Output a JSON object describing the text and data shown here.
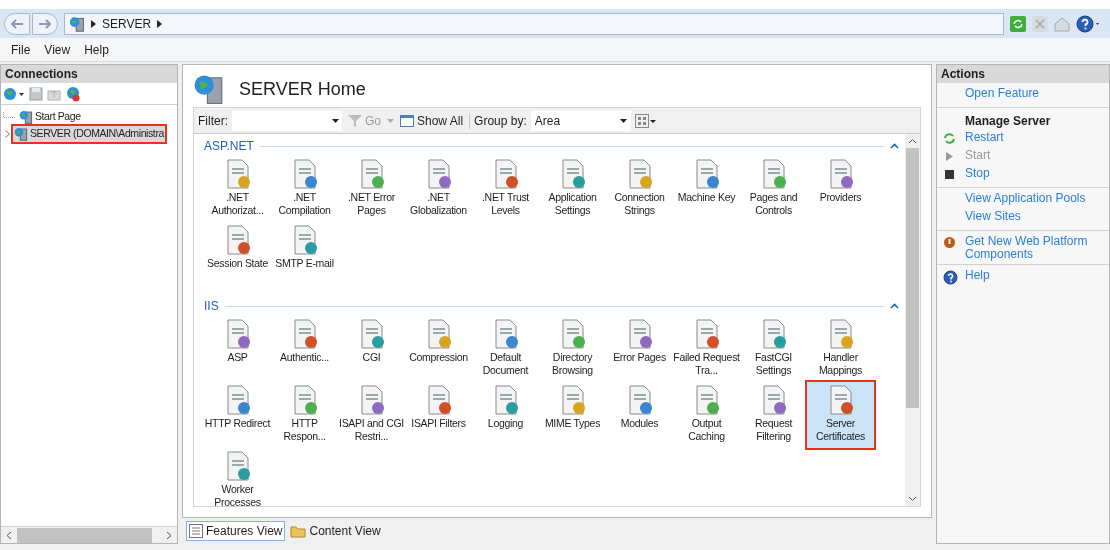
{
  "address_bar": {
    "crumbs": [
      "SERVER"
    ]
  },
  "menu": [
    "File",
    "View",
    "Help"
  ],
  "connections": {
    "title": "Connections",
    "tree": [
      {
        "label": "Start Page",
        "selected": false,
        "expandable": false
      },
      {
        "label": "SERVER (DOMAIN\\Administra",
        "selected": true,
        "expandable": true
      }
    ]
  },
  "center": {
    "title": "SERVER Home",
    "toolbar": {
      "filter_label": "Filter:",
      "go": "Go",
      "show_all": "Show All",
      "group_by_label": "Group by:",
      "group_by_value": "Area"
    },
    "groups": [
      {
        "name": "ASP.NET",
        "items": [
          {
            "label": ".NET Authorizat...",
            "selected": false
          },
          {
            "label": ".NET Compilation",
            "selected": false
          },
          {
            "label": ".NET Error Pages",
            "selected": false
          },
          {
            "label": ".NET Globalization",
            "selected": false
          },
          {
            "label": ".NET Trust Levels",
            "selected": false
          },
          {
            "label": "Application Settings",
            "selected": false
          },
          {
            "label": "Connection Strings",
            "selected": false
          },
          {
            "label": "Machine Key",
            "selected": false
          },
          {
            "label": "Pages and Controls",
            "selected": false
          },
          {
            "label": "Providers",
            "selected": false
          },
          {
            "label": "Session State",
            "selected": false
          },
          {
            "label": "SMTP E-mail",
            "selected": false
          }
        ]
      },
      {
        "name": "IIS",
        "items": [
          {
            "label": "ASP",
            "selected": false
          },
          {
            "label": "Authentic...",
            "selected": false
          },
          {
            "label": "CGI",
            "selected": false
          },
          {
            "label": "Compression",
            "selected": false
          },
          {
            "label": "Default Document",
            "selected": false
          },
          {
            "label": "Directory Browsing",
            "selected": false
          },
          {
            "label": "Error Pages",
            "selected": false
          },
          {
            "label": "Failed Request Tra...",
            "selected": false
          },
          {
            "label": "FastCGI Settings",
            "selected": false
          },
          {
            "label": "Handler Mappings",
            "selected": false
          },
          {
            "label": "HTTP Redirect",
            "selected": false
          },
          {
            "label": "HTTP Respon...",
            "selected": false
          },
          {
            "label": "ISAPI and CGI Restri...",
            "selected": false
          },
          {
            "label": "ISAPI Filters",
            "selected": false
          },
          {
            "label": "Logging",
            "selected": false
          },
          {
            "label": "MIME Types",
            "selected": false
          },
          {
            "label": "Modules",
            "selected": false
          },
          {
            "label": "Output Caching",
            "selected": false
          },
          {
            "label": "Request Filtering",
            "selected": false
          },
          {
            "label": "Server Certificates",
            "selected": true
          },
          {
            "label": "Worker Processes",
            "selected": false
          }
        ]
      }
    ],
    "view_tabs": [
      {
        "label": "Features View",
        "selected": true
      },
      {
        "label": "Content View",
        "selected": false
      }
    ]
  },
  "actions": {
    "title": "Actions",
    "groups": [
      [
        {
          "kind": "link",
          "label": "Open Feature",
          "disabled": false
        }
      ],
      [
        {
          "kind": "heading",
          "label": "Manage Server"
        },
        {
          "kind": "restart",
          "label": "Restart",
          "disabled": false
        },
        {
          "kind": "start",
          "label": "Start",
          "disabled": true
        },
        {
          "kind": "stop",
          "label": "Stop",
          "disabled": false
        }
      ],
      [
        {
          "kind": "link",
          "label": "View Application Pools",
          "disabled": false
        },
        {
          "kind": "link",
          "label": "View Sites",
          "disabled": false
        }
      ],
      [
        {
          "kind": "install",
          "label": "Get New Web Platform Components",
          "disabled": false
        }
      ],
      [
        {
          "kind": "help",
          "label": "Help",
          "disabled": false
        }
      ]
    ]
  }
}
